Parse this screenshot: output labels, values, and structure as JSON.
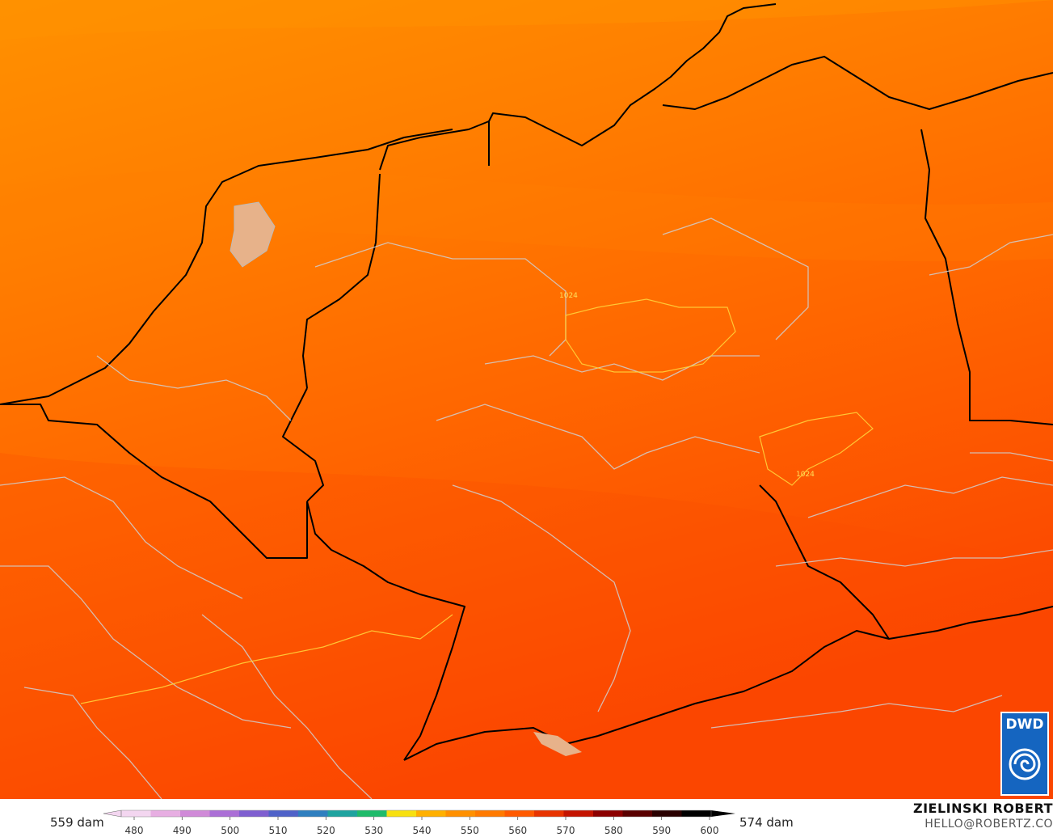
{
  "legend": {
    "min_label": "559 dam",
    "max_label": "574 dam",
    "ticks": [
      "480",
      "490",
      "500",
      "510",
      "520",
      "530",
      "540",
      "550",
      "560",
      "570",
      "580",
      "590",
      "600"
    ],
    "colors": [
      "#f3d6f0",
      "#e7aee2",
      "#d08ad8",
      "#ab6fd6",
      "#7f5fd0",
      "#4f62c8",
      "#2f7fbf",
      "#1fa39f",
      "#1fbb6a",
      "#f7e010",
      "#ffb000",
      "#ff9000",
      "#ff7a00",
      "#ff5a00",
      "#e83400",
      "#c41400",
      "#8c0000",
      "#5a0000",
      "#2a0000",
      "#000000"
    ]
  },
  "map": {
    "isobar_labels": [
      "1024",
      "1024"
    ],
    "field_colors": [
      "#ff8f00",
      "#ff7d00",
      "#ff6a00",
      "#ff5200",
      "#fb4000"
    ]
  },
  "credit": {
    "name": "ZIELINSKI ROBERT",
    "email": "HELLO@ROBERTZ.CO"
  },
  "logo": {
    "text": "DWD"
  }
}
